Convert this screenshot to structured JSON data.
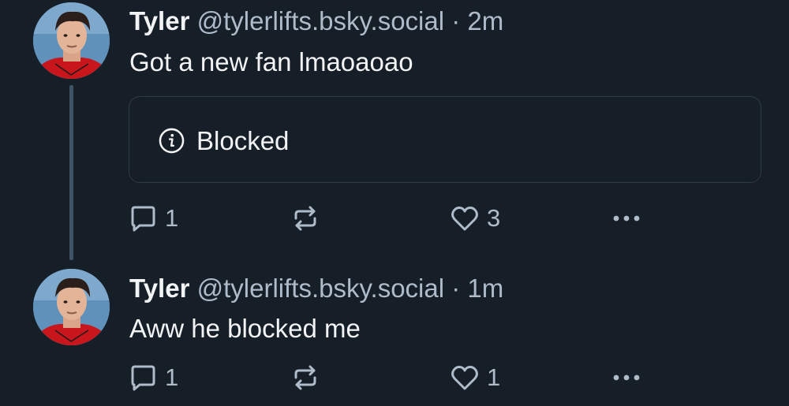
{
  "posts": [
    {
      "author": {
        "name": "Tyler",
        "handle": "@tylerlifts.bsky.social"
      },
      "separator": "·",
      "time": "2m",
      "text": "Got a new fan lmaoaoao",
      "embed": {
        "icon": "info-circle-icon",
        "label": "Blocked"
      },
      "actions": {
        "reply": {
          "icon": "reply-bubble-icon",
          "count": "1"
        },
        "repost": {
          "icon": "repost-icon"
        },
        "like": {
          "icon": "heart-icon",
          "count": "3"
        },
        "more": {
          "icon": "more-dots-icon"
        }
      }
    },
    {
      "author": {
        "name": "Tyler",
        "handle": "@tylerlifts.bsky.social"
      },
      "separator": "·",
      "time": "1m",
      "text": "Aww he blocked me",
      "actions": {
        "reply": {
          "icon": "reply-bubble-icon",
          "count": "1"
        },
        "repost": {
          "icon": "repost-icon"
        },
        "like": {
          "icon": "heart-icon",
          "count": "1"
        },
        "more": {
          "icon": "more-dots-icon"
        }
      }
    }
  ],
  "colors": {
    "background": "#161e27",
    "text_primary": "#f1f3f5",
    "text_secondary": "#aebbc9",
    "thread_line": "#3e5366",
    "card_border": "#2e3a47"
  }
}
